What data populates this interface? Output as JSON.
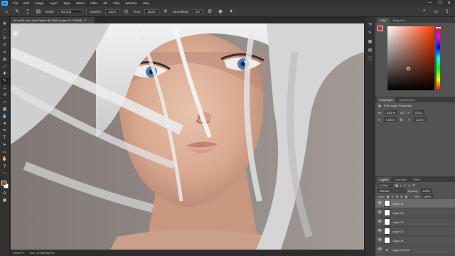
{
  "menubar": {
    "logo": "Ps",
    "items": [
      "File",
      "Edit",
      "Image",
      "Layer",
      "Type",
      "Select",
      "Filter",
      "3D",
      "View",
      "Window",
      "Help"
    ],
    "controls": [
      "—",
      "❐",
      "✕"
    ]
  },
  "optionsbar": {
    "brush_size": "5",
    "mode_label": "Mode:",
    "mode_value": "Normal",
    "opacity_label": "Opacity:",
    "opacity_value": "100%",
    "flow_label": "Flow:",
    "flow_value": "100%",
    "smoothing_label": "Smoothing:",
    "smoothing_value": "0%"
  },
  "document": {
    "tab_title": "a2 cat13 color face Regrid @ 195% (Layer 11, RGB/8)",
    "close": "×"
  },
  "statusbar": {
    "zoom": "194.87%",
    "doc_info": "Doc: 14.8M/553.0M"
  },
  "color_panel": {
    "tabs": [
      "Color",
      "Swatches"
    ],
    "foreground": "#b0392c",
    "background": "#ffffff"
  },
  "properties_panel": {
    "tabs": [
      "Properties",
      "Adjustments"
    ],
    "section_title": "Pixel Layer Properties",
    "w_label": "W:",
    "w_value": "4.61 in",
    "go_label": "GO",
    "x_label": "X:",
    "x_value": "0.2 in",
    "h_label": "H:",
    "h_value": "4.93 in",
    "y_label": "Y:",
    "y_value": "1.22 in"
  },
  "layers_panel": {
    "tabs": [
      "Layers",
      "Channels",
      "Paths"
    ],
    "kind_label": "Kind",
    "blend_mode": "Normal",
    "opacity_label": "Opacity:",
    "opacity_value": "100%",
    "lock_label": "Lock:",
    "fill_label": "Fill:",
    "fill_value": "100%",
    "layers": [
      {
        "name": "Layer 11",
        "selected": true
      },
      {
        "name": "Layer 20",
        "selected": false
      },
      {
        "name": "Layer 18",
        "selected": false
      },
      {
        "name": "Layer 17",
        "selected": false
      },
      {
        "name": "Layer 16",
        "selected": false
      },
      {
        "name": "Layer 3 Gr. B",
        "selected": false
      }
    ]
  }
}
